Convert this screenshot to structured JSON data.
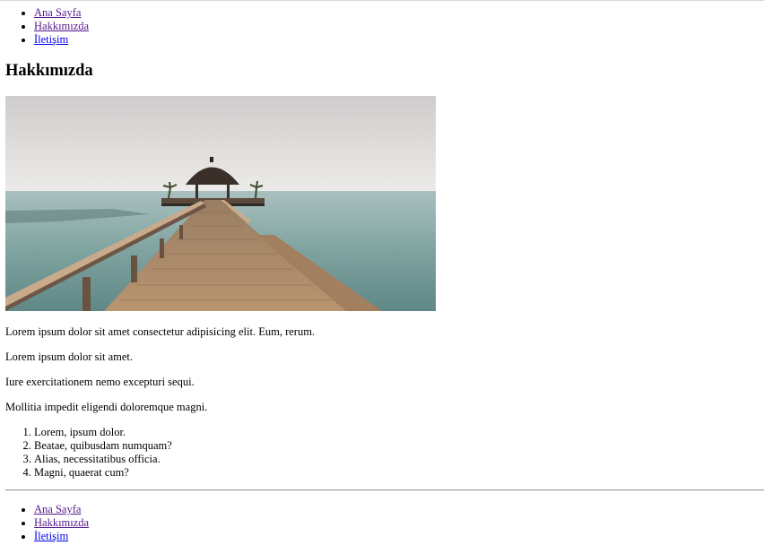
{
  "nav_top": {
    "items": [
      {
        "label": "Ana Sayfa"
      },
      {
        "label": "Hakkımızda"
      },
      {
        "label": "İletişim"
      }
    ]
  },
  "page": {
    "heading": "Hakkımızda",
    "hero_image": "pier-over-sea-photo"
  },
  "content": {
    "paragraphs": [
      "Lorem ipsum dolor sit amet consectetur adipisicing elit. Eum, rerum.",
      "Lorem ipsum dolor sit amet.",
      "Iure exercitationem nemo excepturi sequi.",
      "Mollitia impedit eligendi doloremque magni."
    ],
    "list": [
      "Lorem, ipsum dolor.",
      "Beatae, quibusdam numquam?",
      "Alias, necessitatibus officia.",
      "Magni, quaerat cum?"
    ]
  },
  "nav_bottom": {
    "items": [
      {
        "label": "Ana Sayfa"
      },
      {
        "label": "Hakkımızda"
      },
      {
        "label": "İletişim"
      }
    ]
  },
  "colors": {
    "link": "#0000ee",
    "visited_link": "#551a8b",
    "separator": "#9a9a9a"
  }
}
